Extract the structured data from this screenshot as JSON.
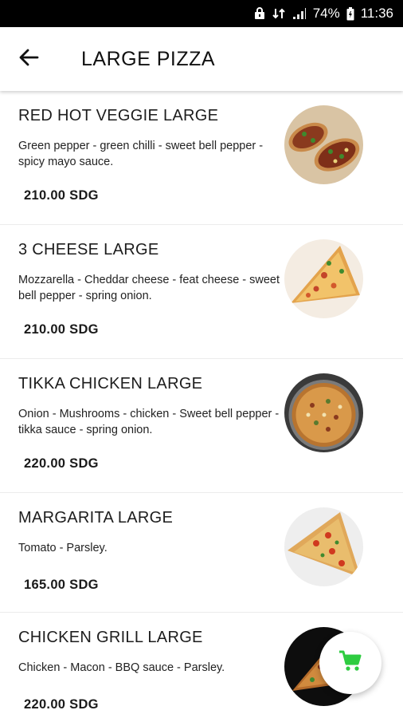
{
  "status_bar": {
    "battery": "74%",
    "time": "11:36"
  },
  "header": {
    "title": "LARGE PIZZA",
    "back_icon": "arrow-left-icon"
  },
  "items": [
    {
      "name": "RED HOT VEGGIE LARGE",
      "description": "Green pepper - green chilli - sweet bell pepper - spicy mayo sauce.",
      "price": "210.00 SDG"
    },
    {
      "name": "3 CHEESE LARGE",
      "description": "Mozzarella - Cheddar cheese - feat cheese - sweet bell pepper - spring onion.",
      "price": "210.00 SDG"
    },
    {
      "name": "TIKKA CHICKEN LARGE",
      "description": "Onion - Mushrooms - chicken - Sweet bell pepper - tikka sauce - spring onion.",
      "price": "220.00 SDG"
    },
    {
      "name": "MARGARITA LARGE",
      "description": "Tomato - Parsley.",
      "price": "165.00 SDG"
    },
    {
      "name": "CHICKEN GRILL LARGE",
      "description": "Chicken - Macon - BBQ sauce - Parsley.",
      "price": "220.00 SDG"
    }
  ],
  "fab": {
    "icon": "shopping-cart-icon",
    "color": "#2ecc40"
  }
}
